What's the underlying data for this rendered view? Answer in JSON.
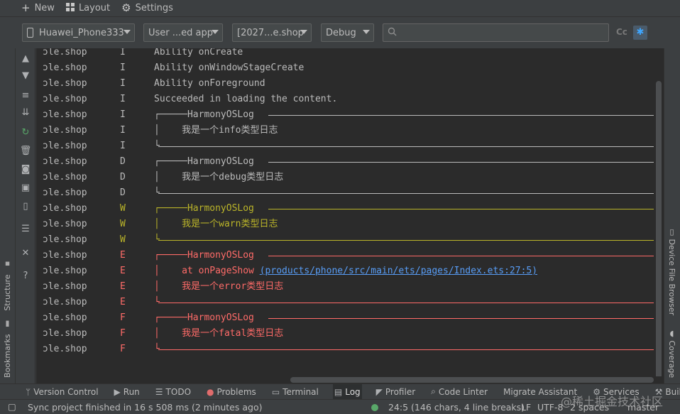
{
  "toolbar": {
    "new_label": "New",
    "layout_label": "Layout",
    "settings_label": "Settings"
  },
  "filters": {
    "device": "Huawei_Phone333",
    "app_filter": "User ...ed app",
    "process": "[2027...e.shop",
    "level": "Debug",
    "search_value": "",
    "case_label": "Cc",
    "regex_icon": "regex-icon"
  },
  "left_tabs": {
    "structure": "Structure",
    "bookmarks": "Bookmarks"
  },
  "right_tabs": {
    "device_file_browser": "Device File Browser",
    "coverage": "Coverage"
  },
  "log": {
    "colors": {
      "info": "#bbbbbb",
      "debug": "#bbbbbb",
      "warn": "#bbb529",
      "error": "#ff6b68",
      "fatal": "#ff6b68"
    },
    "rows": [
      {
        "tag": "ɔle.shop",
        "level": "I",
        "message": "Ability onCreate"
      },
      {
        "tag": "ɔle.shop",
        "level": "I",
        "message": "Ability onWindowStageCreate"
      },
      {
        "tag": "ɔle.shop",
        "level": "I",
        "message": "Ability onForeground"
      },
      {
        "tag": "ɔle.shop",
        "level": "I",
        "message": "Succeeded in loading the content."
      },
      {
        "tag": "ɔle.shop",
        "level": "I",
        "message": "┌─────HarmonyOSLog"
      },
      {
        "tag": "ɔle.shop",
        "level": "I",
        "message": "│    我是一个info类型日志"
      },
      {
        "tag": "ɔle.shop",
        "level": "I",
        "message": "└"
      },
      {
        "tag": "ɔle.shop",
        "level": "D",
        "message": "┌─────HarmonyOSLog"
      },
      {
        "tag": "ɔle.shop",
        "level": "D",
        "message": "│    我是一个debug类型日志"
      },
      {
        "tag": "ɔle.shop",
        "level": "D",
        "message": "└"
      },
      {
        "tag": "ɔle.shop",
        "level": "W",
        "message": "┌─────HarmonyOSLog"
      },
      {
        "tag": "ɔle.shop",
        "level": "W",
        "message": "│    我是一个warn类型日志"
      },
      {
        "tag": "ɔle.shop",
        "level": "W",
        "message": "└"
      },
      {
        "tag": "ɔle.shop",
        "level": "E",
        "message": "┌─────HarmonyOSLog"
      },
      {
        "tag": "ɔle.shop",
        "level": "E",
        "message": "│    at onPageShow ",
        "link": "(products/phone/src/main/ets/pages/Index.ets:27:5)"
      },
      {
        "tag": "ɔle.shop",
        "level": "E",
        "message": "│    我是一个error类型日志"
      },
      {
        "tag": "ɔle.shop",
        "level": "E",
        "message": "└"
      },
      {
        "tag": "ɔle.shop",
        "level": "F",
        "message": "┌─────HarmonyOSLog"
      },
      {
        "tag": "ɔle.shop",
        "level": "F",
        "message": "│    我是一个fatal类型日志"
      },
      {
        "tag": "ɔle.shop",
        "level": "F",
        "message": "└"
      }
    ]
  },
  "bottom_tabs": [
    {
      "label": "Version Control",
      "icon": "branch-icon"
    },
    {
      "label": "Run",
      "icon": "run-icon"
    },
    {
      "label": "TODO",
      "icon": "todo-icon"
    },
    {
      "label": "Problems",
      "icon": "problems-icon"
    },
    {
      "label": "Terminal",
      "icon": "terminal-icon"
    },
    {
      "label": "Log",
      "icon": "log-icon"
    },
    {
      "label": "Profiler",
      "icon": "profiler-icon"
    },
    {
      "label": "Code Linter",
      "icon": "linter-icon"
    },
    {
      "label": "Migrate Assistant",
      "icon": ""
    },
    {
      "label": "Services",
      "icon": "services-icon"
    },
    {
      "label": "Build",
      "icon": "build-icon"
    }
  ],
  "status": {
    "message": "Sync project finished in 16 s 508 ms (2 minutes ago)",
    "position": "24:5 (146 chars, 4 line breaks)",
    "line_ending": "LF",
    "encoding": "UTF-8",
    "indent": "2 spaces",
    "branch": "master"
  },
  "watermark": "@稀土掘金技术社区"
}
